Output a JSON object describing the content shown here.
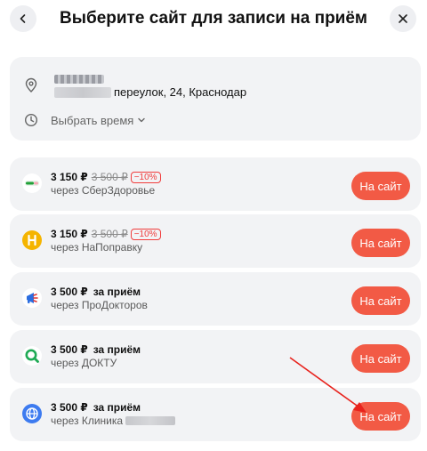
{
  "header": {
    "title": "Выберите сайт для записи на приём",
    "back_icon": "chevron-left-icon",
    "close_icon": "close-icon"
  },
  "location": {
    "address": "переулок, 24, Краснодар",
    "time_label": "Выбрать время"
  },
  "sites": [
    {
      "price": "3 150 ₽",
      "old_price": "3 500 ₽",
      "discount": "−10%",
      "via": "через СберЗдоровье",
      "button": "На сайт",
      "logo": "sberzdorovie-logo"
    },
    {
      "price": "3 150 ₽",
      "old_price": "3 500 ₽",
      "discount": "−10%",
      "via": "через НаПоправку",
      "button": "На сайт",
      "logo": "naporavku-logo"
    },
    {
      "price": "3 500 ₽",
      "per_visit": "за приём",
      "via": "через ПроДокторов",
      "button": "На сайт",
      "logo": "prodoktorov-logo"
    },
    {
      "price": "3 500 ₽",
      "per_visit": "за приём",
      "via": "через ДОКТУ",
      "button": "На сайт",
      "logo": "doktu-logo"
    },
    {
      "price": "3 500 ₽",
      "per_visit": "за приём",
      "via": "через Клиника",
      "button": "На сайт",
      "logo": "globe-icon"
    }
  ],
  "colors": {
    "accent": "#f25a45",
    "card_bg": "#f2f3f5",
    "annotation_arrow": "#e8231d"
  }
}
